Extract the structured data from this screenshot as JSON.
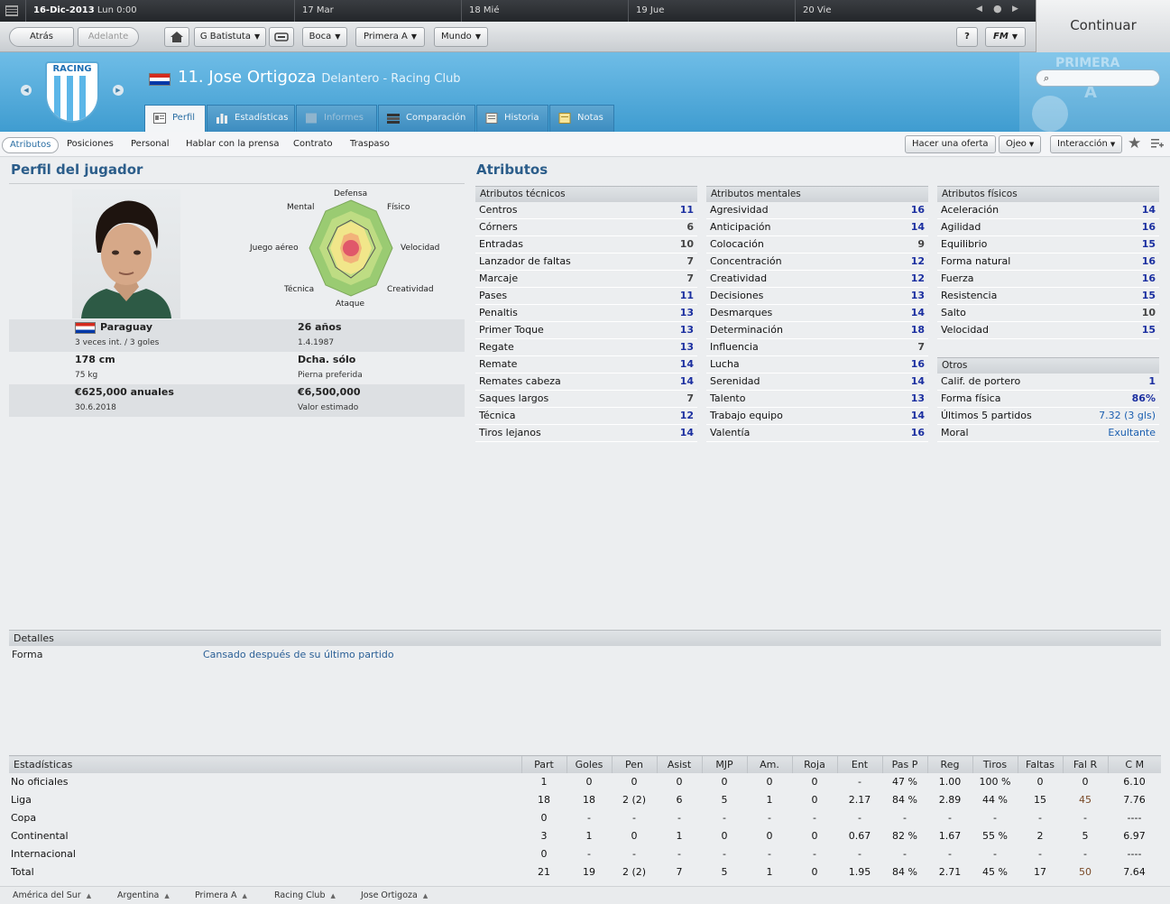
{
  "calendar": {
    "current": "16-Dic-2013",
    "current_time": "Lun 0:00",
    "days": [
      {
        "num": "17",
        "name": "Mar"
      },
      {
        "num": "18",
        "name": "Mié"
      },
      {
        "num": "19",
        "name": "Jue"
      },
      {
        "num": "20",
        "name": "Vie"
      }
    ]
  },
  "toolbar": {
    "back": "Atrás",
    "forward": "Adelante",
    "manager": "G Batistuta",
    "club": "Boca",
    "league": "Primera A",
    "world": "Mundo",
    "help": "?",
    "fm": "FM"
  },
  "continue_label": "Continuar",
  "header": {
    "crest_text": "RACING",
    "player_title": "11. Jose Ortigoza",
    "player_subtitle": "Delantero - Racing Club",
    "league_badge_top": "PRIMERA",
    "league_badge_letter": "A"
  },
  "tabs": [
    "Perfil",
    "Estadísticas",
    "Informes",
    "Comparación",
    "Historia",
    "Notas"
  ],
  "subnav": [
    "Atributos",
    "Posiciones",
    "Personal",
    "Hablar con la prensa",
    "Contrato",
    "Traspaso"
  ],
  "actions": {
    "offer": "Hacer una oferta",
    "scout": "Ojeo",
    "interaction": "Interacción"
  },
  "profile": {
    "title": "Perfil del jugador",
    "radar_labels": [
      "Defensa",
      "Físico",
      "Velocidad",
      "Creatividad",
      "Ataque",
      "Técnica",
      "Juego aéreo",
      "Mental"
    ],
    "nationality": "Paraguay",
    "caps": "3 veces int. / 3 goles",
    "age": "26 años",
    "birth": "1.4.1987",
    "height": "178 cm",
    "weight": "75 kg",
    "foot": "Dcha. sólo",
    "foot_label": "Pierna preferida",
    "wage": "€625,000 anuales",
    "contract_end": "30.6.2018",
    "value": "€6,500,000",
    "value_label": "Valor estimado"
  },
  "attributes": {
    "title": "Atributos",
    "technical": {
      "header": "Atributos técnicos",
      "items": [
        {
          "name": "Centros",
          "value": "11"
        },
        {
          "name": "Córners",
          "value": "6"
        },
        {
          "name": "Entradas",
          "value": "10"
        },
        {
          "name": "Lanzador de faltas",
          "value": "7"
        },
        {
          "name": "Marcaje",
          "value": "7"
        },
        {
          "name": "Pases",
          "value": "11"
        },
        {
          "name": "Penaltis",
          "value": "13"
        },
        {
          "name": "Primer Toque",
          "value": "13"
        },
        {
          "name": "Regate",
          "value": "13"
        },
        {
          "name": "Remate",
          "value": "14"
        },
        {
          "name": "Remates cabeza",
          "value": "14"
        },
        {
          "name": "Saques largos",
          "value": "7"
        },
        {
          "name": "Técnica",
          "value": "12"
        },
        {
          "name": "Tiros lejanos",
          "value": "14"
        }
      ]
    },
    "mental": {
      "header": "Atributos mentales",
      "items": [
        {
          "name": "Agresividad",
          "value": "16"
        },
        {
          "name": "Anticipación",
          "value": "14"
        },
        {
          "name": "Colocación",
          "value": "9"
        },
        {
          "name": "Concentración",
          "value": "12"
        },
        {
          "name": "Creatividad",
          "value": "12"
        },
        {
          "name": "Decisiones",
          "value": "13"
        },
        {
          "name": "Desmarques",
          "value": "14"
        },
        {
          "name": "Determinación",
          "value": "18"
        },
        {
          "name": "Influencia",
          "value": "7"
        },
        {
          "name": "Lucha",
          "value": "16"
        },
        {
          "name": "Serenidad",
          "value": "14"
        },
        {
          "name": "Talento",
          "value": "13"
        },
        {
          "name": "Trabajo equipo",
          "value": "14"
        },
        {
          "name": "Valentía",
          "value": "16"
        }
      ]
    },
    "physical": {
      "header": "Atributos físicos",
      "items": [
        {
          "name": "Aceleración",
          "value": "14"
        },
        {
          "name": "Agilidad",
          "value": "16"
        },
        {
          "name": "Equilibrio",
          "value": "15"
        },
        {
          "name": "Forma natural",
          "value": "16"
        },
        {
          "name": "Fuerza",
          "value": "16"
        },
        {
          "name": "Resistencia",
          "value": "15"
        },
        {
          "name": "Salto",
          "value": "10"
        },
        {
          "name": "Velocidad",
          "value": "15"
        }
      ]
    },
    "other": {
      "header": "Otros",
      "items": [
        {
          "name": "Calif. de portero",
          "value": "1"
        },
        {
          "name": "Forma física",
          "value": "86%"
        },
        {
          "name": "Últimos 5 partidos",
          "value": "7.32 (3 gls)"
        },
        {
          "name": "Moral",
          "value": "Exultante"
        }
      ]
    }
  },
  "details": {
    "header": "Detalles",
    "label": "Forma",
    "value": "Cansado después de su último partido"
  },
  "stats": {
    "headers": [
      "Estadísticas",
      "Part",
      "Goles",
      "Pen",
      "Asist",
      "MJP",
      "Am.",
      "Roja",
      "Ent",
      "Pas P",
      "Reg",
      "Tiros",
      "Faltas",
      "Fal R",
      "C M"
    ],
    "rows": [
      [
        "No oficiales",
        "1",
        "0",
        "0",
        "0",
        "0",
        "0",
        "0",
        "-",
        "47 %",
        "1.00",
        "100 %",
        "0",
        "0",
        "6.10"
      ],
      [
        "Liga",
        "18",
        "18",
        "2 (2)",
        "6",
        "5",
        "1",
        "0",
        "2.17",
        "84 %",
        "2.89",
        "44 %",
        "15",
        "45",
        "7.76"
      ],
      [
        "Copa",
        "0",
        "-",
        "-",
        "-",
        "-",
        "-",
        "-",
        "-",
        "-",
        "-",
        "-",
        "-",
        "-",
        "----"
      ],
      [
        "Continental",
        "3",
        "1",
        "0",
        "1",
        "0",
        "0",
        "0",
        "0.67",
        "82 %",
        "1.67",
        "55 %",
        "2",
        "5",
        "6.97"
      ],
      [
        "Internacional",
        "0",
        "-",
        "-",
        "-",
        "-",
        "-",
        "-",
        "-",
        "-",
        "-",
        "-",
        "-",
        "-",
        "----"
      ],
      [
        "Total",
        "21",
        "19",
        "2 (2)",
        "7",
        "5",
        "1",
        "0",
        "1.95",
        "84 %",
        "2.71",
        "45 %",
        "17",
        "50",
        "7.64"
      ]
    ]
  },
  "breadcrumb": [
    "América del Sur",
    "Argentina",
    "Primera A",
    "Racing Club",
    "Jose Ortigoza"
  ],
  "colors": {
    "accent": "#3f9cd0",
    "value_high": "#1b2fa0",
    "link": "#1b5fb0"
  }
}
